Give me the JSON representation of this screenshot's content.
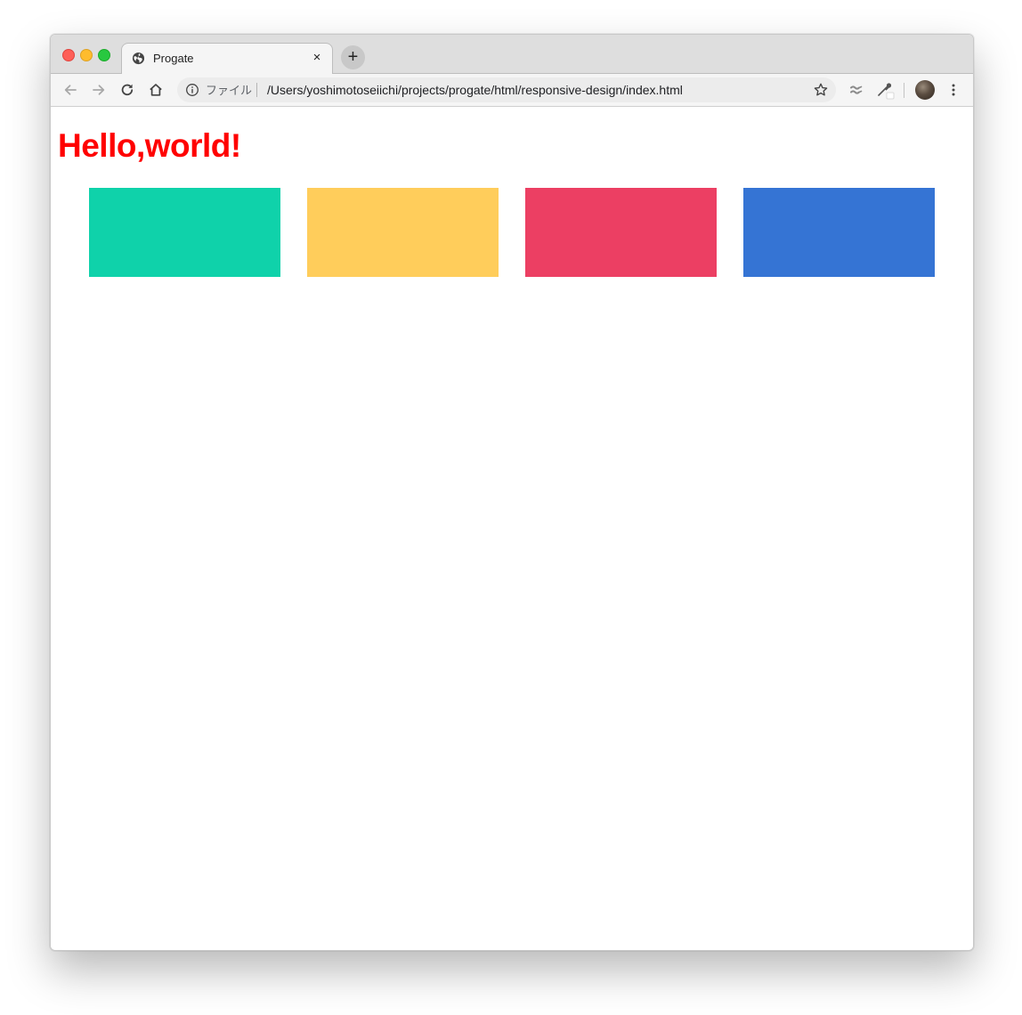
{
  "browser": {
    "tab": {
      "title": "Progate",
      "close_glyph": "×",
      "icon": "globe-icon"
    },
    "new_tab_glyph": "+",
    "toolbar": {
      "back_icon": "back-arrow-icon",
      "forward_icon": "forward-arrow-icon",
      "reload_icon": "reload-icon",
      "home_icon": "home-icon",
      "extension_icons": [
        "extension-icon",
        "eyedropper-icon"
      ],
      "menu_icon": "kebab-menu-icon"
    },
    "address_bar": {
      "security_label": "ファイル",
      "url": "/Users/yoshimotoseiichi/projects/progate/html/responsive-design/index.html",
      "bookmark_icon": "star-icon"
    }
  },
  "page": {
    "heading": "Hello,world!",
    "heading_color": "#ff0000",
    "boxes": [
      {
        "color": "#0fd2aa"
      },
      {
        "color": "#ffcd5b"
      },
      {
        "color": "#ec3f63"
      },
      {
        "color": "#3574d4"
      }
    ]
  }
}
